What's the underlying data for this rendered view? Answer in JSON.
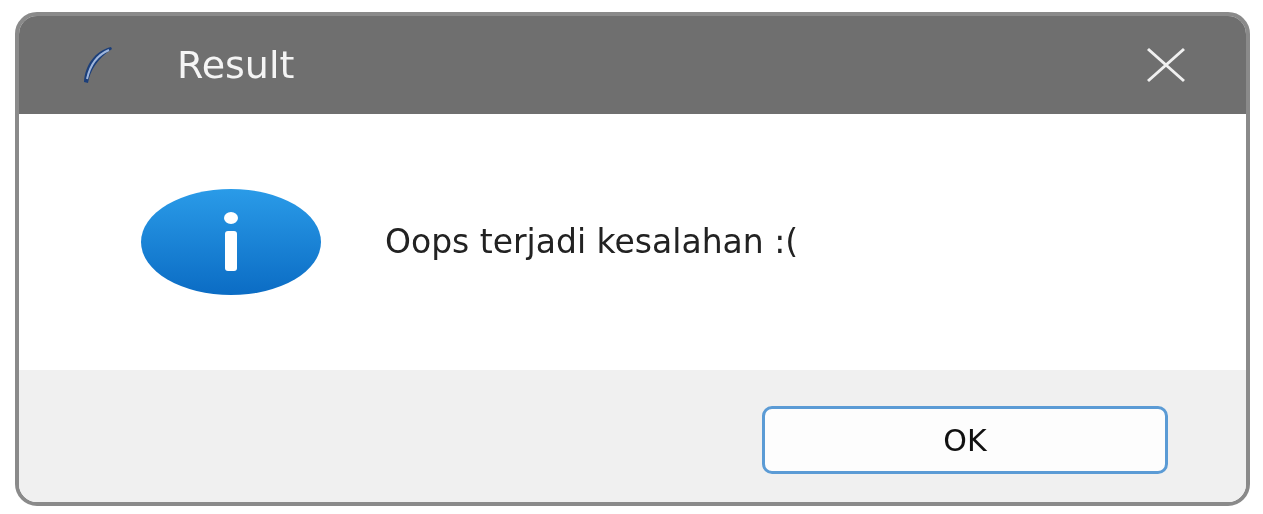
{
  "window": {
    "title": "Result"
  },
  "message": "Oops terjadi kesalahan :(",
  "buttons": [
    {
      "label": "OK",
      "selected": true
    }
  ]
}
